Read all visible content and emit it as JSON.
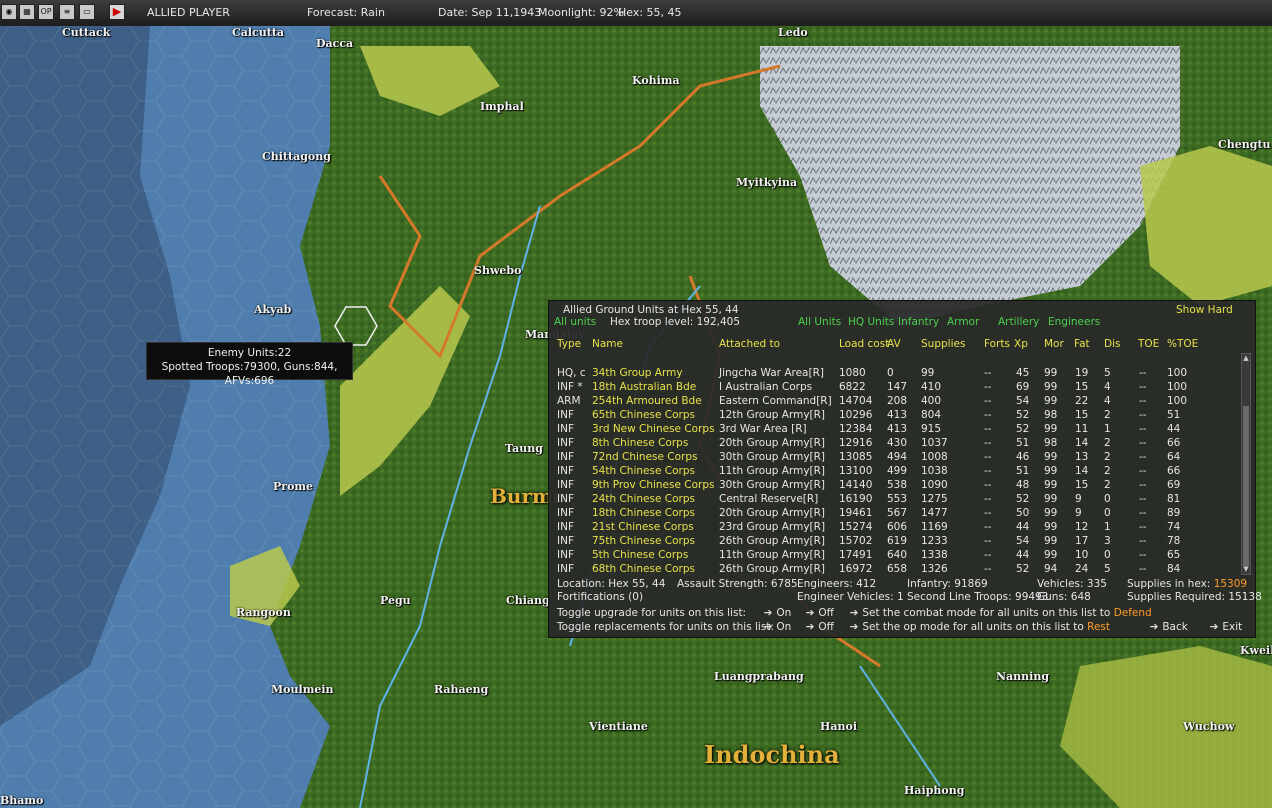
{
  "topbar": {
    "icons": [
      "globe-icon",
      "map-icon",
      "op-icon",
      "list-icon",
      "window-icon",
      "play-icon"
    ],
    "op_icon_label": "OP",
    "player": "ALLIED PLAYER",
    "forecast": "Forecast: Rain",
    "date": "Date: Sep 11,1943",
    "moonlight": "Moonlight: 92%",
    "hex": "Hex: 55, 45"
  },
  "map": {
    "cities": [
      "Cuttack",
      "Calcutta",
      "Dacca",
      "Ledo",
      "Kohima",
      "Imphal",
      "Chittagong",
      "Myitkyina",
      "Chengtu",
      "Shwebo",
      "Akyab",
      "Mandalay",
      "Taung",
      "Prome",
      "Pegu",
      "Chiang",
      "Rangoon",
      "Moulmein",
      "Rahaeng",
      "Luangprabang",
      "Vientiane",
      "Hanoi",
      "Nanning",
      "Kweilin",
      "Wuchow",
      "Haiphong",
      "Bhamo"
    ],
    "regions": [
      "Burma",
      "Indochina"
    ],
    "colors": {
      "ocean_deep": "#3e5f86",
      "ocean_shallow": "#4f7eae",
      "jungle": "#3f6a23",
      "clear": "#b8c84e",
      "mountain": "#c9cfd6",
      "border": "#d4782a",
      "river": "#5fb3e8"
    }
  },
  "tooltip": {
    "line1": "Enemy Units:22",
    "line2": "Spotted Troops:79300, Guns:844, AFVs:696"
  },
  "panel": {
    "title": "Allied Ground Units at Hex 55, 44",
    "show_hard": "Show Hard",
    "all_units_link": "All units",
    "troop_level": "Hex troop level: 192,405",
    "filters": [
      "All Units",
      "HQ Units",
      "Infantry",
      "Armor",
      "Artillery",
      "Engineers"
    ],
    "columns": [
      "Type",
      "Name",
      "Attached to",
      "Load cost",
      "AV",
      "Supplies",
      "Forts",
      "Xp",
      "Mor",
      "Fat",
      "Dis",
      "TOE",
      "%TOE"
    ],
    "rows": [
      {
        "type": "HQ, c",
        "name": "34th Group Army",
        "attached": "Jingcha War Area[R]",
        "load": "1080",
        "av": "0",
        "sup": "99",
        "forts": "--",
        "xp": "45",
        "mor": "99",
        "fat": "19",
        "dis": "5",
        "toe": "--",
        "ptoe": "100"
      },
      {
        "type": "INF *",
        "name": "18th Australian Bde",
        "attached": "I Australian Corps",
        "load": "6822",
        "av": "147",
        "sup": "410",
        "forts": "--",
        "xp": "69",
        "mor": "99",
        "fat": "15",
        "dis": "4",
        "toe": "--",
        "ptoe": "100"
      },
      {
        "type": "ARM",
        "name": "254th Armoured Bde",
        "attached": "Eastern Command[R]",
        "load": "14704",
        "av": "208",
        "sup": "400",
        "forts": "--",
        "xp": "54",
        "mor": "99",
        "fat": "22",
        "dis": "4",
        "toe": "--",
        "ptoe": "100"
      },
      {
        "type": "INF",
        "name": "65th Chinese Corps",
        "attached": "12th Group Army[R]",
        "load": "10296",
        "av": "413",
        "sup": "804",
        "forts": "--",
        "xp": "52",
        "mor": "98",
        "fat": "15",
        "dis": "2",
        "toe": "--",
        "ptoe": "51"
      },
      {
        "type": "INF",
        "name": "3rd New Chinese Corps",
        "attached": "3rd War Area [R]",
        "load": "12384",
        "av": "413",
        "sup": "915",
        "forts": "--",
        "xp": "52",
        "mor": "99",
        "fat": "11",
        "dis": "1",
        "toe": "--",
        "ptoe": "44"
      },
      {
        "type": "INF",
        "name": "8th Chinese Corps",
        "attached": "20th Group Army[R]",
        "load": "12916",
        "av": "430",
        "sup": "1037",
        "forts": "--",
        "xp": "51",
        "mor": "98",
        "fat": "14",
        "dis": "2",
        "toe": "--",
        "ptoe": "66"
      },
      {
        "type": "INF",
        "name": "72nd Chinese Corps",
        "attached": "30th Group Army[R]",
        "load": "13085",
        "av": "494",
        "sup": "1008",
        "forts": "--",
        "xp": "46",
        "mor": "99",
        "fat": "13",
        "dis": "2",
        "toe": "--",
        "ptoe": "64"
      },
      {
        "type": "INF",
        "name": "54th Chinese Corps",
        "attached": "11th Group Army[R]",
        "load": "13100",
        "av": "499",
        "sup": "1038",
        "forts": "--",
        "xp": "51",
        "mor": "99",
        "fat": "14",
        "dis": "2",
        "toe": "--",
        "ptoe": "66"
      },
      {
        "type": "INF",
        "name": "9th Prov Chinese Corps",
        "attached": "30th Group Army[R]",
        "load": "14140",
        "av": "538",
        "sup": "1090",
        "forts": "--",
        "xp": "48",
        "mor": "99",
        "fat": "15",
        "dis": "2",
        "toe": "--",
        "ptoe": "69"
      },
      {
        "type": "INF",
        "name": "24th Chinese Corps",
        "attached": "Central Reserve[R]",
        "load": "16190",
        "av": "553",
        "sup": "1275",
        "forts": "--",
        "xp": "52",
        "mor": "99",
        "fat": "9",
        "dis": "0",
        "toe": "--",
        "ptoe": "81"
      },
      {
        "type": "INF",
        "name": "18th Chinese Corps",
        "attached": "20th Group Army[R]",
        "load": "19461",
        "av": "567",
        "sup": "1477",
        "forts": "--",
        "xp": "50",
        "mor": "99",
        "fat": "9",
        "dis": "0",
        "toe": "--",
        "ptoe": "89"
      },
      {
        "type": "INF",
        "name": "21st Chinese Corps",
        "attached": "23rd Group Army[R]",
        "load": "15274",
        "av": "606",
        "sup": "1169",
        "forts": "--",
        "xp": "44",
        "mor": "99",
        "fat": "12",
        "dis": "1",
        "toe": "--",
        "ptoe": "74"
      },
      {
        "type": "INF",
        "name": "75th Chinese Corps",
        "attached": "26th Group Army[R]",
        "load": "15702",
        "av": "619",
        "sup": "1233",
        "forts": "--",
        "xp": "54",
        "mor": "99",
        "fat": "17",
        "dis": "3",
        "toe": "--",
        "ptoe": "78"
      },
      {
        "type": "INF",
        "name": "5th Chinese Corps",
        "attached": "11th Group Army[R]",
        "load": "17491",
        "av": "640",
        "sup": "1338",
        "forts": "--",
        "xp": "44",
        "mor": "99",
        "fat": "10",
        "dis": "0",
        "toe": "--",
        "ptoe": "65"
      },
      {
        "type": "INF",
        "name": "68th Chinese Corps",
        "attached": "26th Group Army[R]",
        "load": "16972",
        "av": "658",
        "sup": "1326",
        "forts": "--",
        "xp": "52",
        "mor": "94",
        "fat": "24",
        "dis": "5",
        "toe": "--",
        "ptoe": "84"
      }
    ],
    "summary": {
      "location": "Location: Hex 55, 44",
      "assault": "Assault Strength: 6785",
      "engineers": "Engineers: 412",
      "infantry": "Infantry: 91869",
      "vehicles": "Vehicles: 335",
      "supplies_in_hex_label": "Supplies in hex:",
      "supplies_in_hex_value": "15309",
      "fortifications": "Fortifications (0)",
      "eng_vehicles": "Engineer Vehicles: 1",
      "second_line": "Second Line Troops: 99493",
      "guns": "Guns: 648",
      "supplies_required": "Supplies Required: 15138"
    },
    "controls": {
      "toggle_upgrade": "Toggle upgrade for units on this list:",
      "toggle_replacements": "Toggle replacements for units on this list:",
      "on": "On",
      "off": "Off",
      "combat_mode_label": "Set the combat mode for all units on this list to",
      "combat_mode_value": "Defend",
      "op_mode_label": "Set the op mode for all units on this list to",
      "op_mode_value": "Rest",
      "back": "Back",
      "exit": "Exit"
    }
  }
}
